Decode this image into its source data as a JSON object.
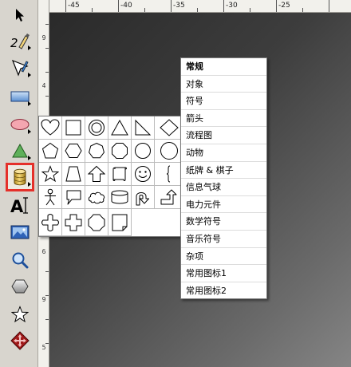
{
  "toolbar": {
    "tools": [
      {
        "id": "pointer",
        "icon": "arrow-pointer-icon"
      },
      {
        "id": "text-path",
        "icon": "text-path-pen-icon"
      },
      {
        "id": "pen",
        "icon": "pen-nib-icon"
      },
      {
        "id": "rectangle",
        "icon": "rectangle-icon"
      },
      {
        "id": "ellipse",
        "icon": "ellipse-icon"
      },
      {
        "id": "triangle",
        "icon": "triangle-icon"
      },
      {
        "id": "shapes",
        "icon": "cylinder-icon",
        "active": true
      },
      {
        "id": "text",
        "icon": "text-cursor-icon",
        "label": "A"
      },
      {
        "id": "image",
        "icon": "image-icon"
      },
      {
        "id": "zoom",
        "icon": "magnifier-icon"
      },
      {
        "id": "polygon",
        "icon": "hexagon-icon"
      },
      {
        "id": "star",
        "icon": "star-icon"
      },
      {
        "id": "transform",
        "icon": "move-diamond-icon"
      }
    ]
  },
  "ruler": {
    "h_labels": [
      "-45",
      "-40",
      "-35",
      "-30",
      "-25"
    ],
    "v_labels": [
      "9",
      "4",
      "6",
      "9",
      "5"
    ]
  },
  "palette": {
    "shapes": [
      "heart",
      "square",
      "circle-ring",
      "triangle",
      "right-triangle",
      "diamond",
      "pentagon",
      "hexagon",
      "heptagon",
      "octagon",
      "circle",
      "circle-outline",
      "star",
      "trapezoid",
      "arrow-up",
      "scroll",
      "smiley",
      "brace",
      "stick-figure",
      "speech-bubble",
      "cloud",
      "cylinder",
      "u-turn-arrow",
      "corner-arrow",
      "puzzle-cross",
      "cross",
      "rounded-octagon",
      "folded-page"
    ]
  },
  "menu": {
    "items": [
      {
        "label": "常规",
        "bold": true
      },
      {
        "label": "对象"
      },
      {
        "label": "符号"
      },
      {
        "label": "箭头"
      },
      {
        "label": "流程图"
      },
      {
        "label": "动物"
      },
      {
        "label": "纸牌 & 棋子"
      },
      {
        "label": "信息气球"
      },
      {
        "label": "电力元件"
      },
      {
        "label": "数学符号"
      },
      {
        "label": "音乐符号"
      },
      {
        "label": "杂项"
      },
      {
        "label": "常用图标1"
      },
      {
        "label": "常用图标2"
      }
    ]
  },
  "colors": {
    "highlight": "#e5302a",
    "ellipse_fill": "#f4a6b0",
    "triangle_fill": "#5fb05a",
    "cylinder_fill": "#e8c250",
    "transform_fill": "#a01818"
  }
}
